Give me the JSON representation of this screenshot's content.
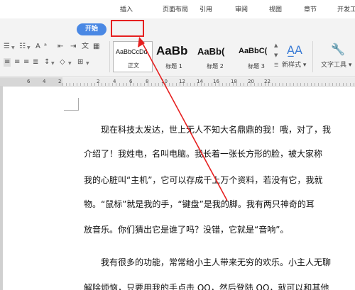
{
  "menu": {
    "start": "开始",
    "tabs": [
      "插入",
      "页面布局",
      "引用",
      "审阅",
      "视图",
      "章节",
      "开发工"
    ]
  },
  "ribbon": {
    "styles": [
      {
        "sample": "AaBbCcDd",
        "name": "正文"
      },
      {
        "sample": "AaBb",
        "name": "标题 1"
      },
      {
        "sample": "AaBb(",
        "name": "标题 2"
      },
      {
        "sample": "AaBbC(",
        "name": "标题 3"
      }
    ],
    "new_style": "新样式",
    "text_tools": "文字工具"
  },
  "ruler": {
    "numbers": [
      "6",
      "4",
      "2",
      "2",
      "4",
      "6",
      "8",
      "10",
      "12",
      "14",
      "16",
      "18",
      "20",
      "22"
    ]
  },
  "document": {
    "lines": [
      "现在科技太发达，世上无人不知大名鼎鼎的我！哦，对了，我",
      "介绍了！我姓电，名叫电脑。我长着一张长方形的脸，被大家称",
      "我的心脏叫“主机”，它可以存成千上万个资料，若没有它，我就",
      "物。“鼠标”就是我的手，“键盘”是我的脚。我有两只神奇的耳",
      "放音乐。你们猜出它是谁了吗？没错，它就是“音响”。",
      "我有很多的功能，常常给小主人带来无穷的欢乐。小主人无聊",
      "解除烦恼，只要用我的手点击 QQ，然后登陆 QQ，就可以和其他"
    ]
  },
  "colors": {
    "accent": "#4a88e4",
    "highlight": "#e62020"
  }
}
